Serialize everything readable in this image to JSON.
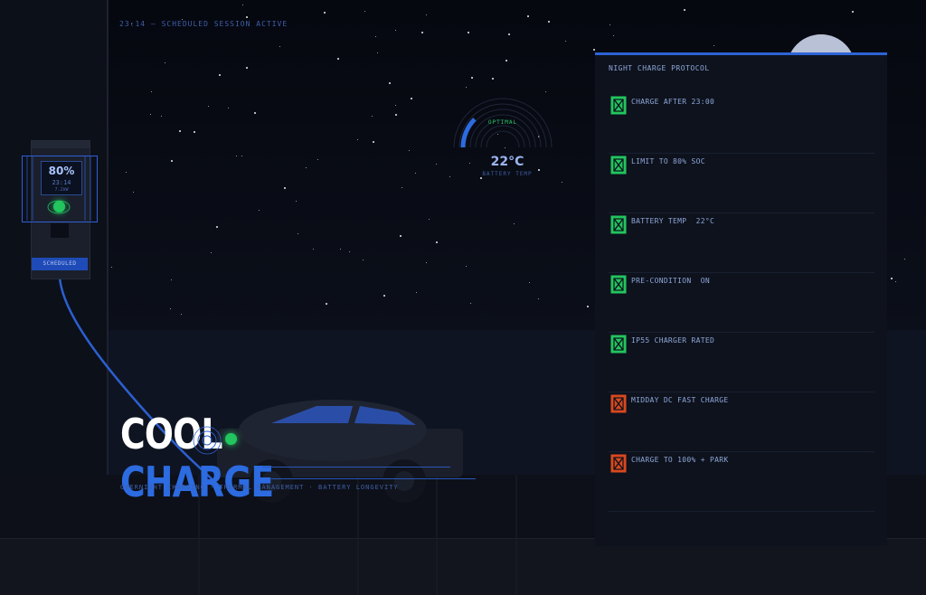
{
  "status": {
    "time": "23:14",
    "message": "SCHEDULED SESSION ACTIVE"
  },
  "gauge": {
    "state": "OPTIMAL",
    "temperature": "22°C",
    "caption": "BATTERY TEMP",
    "fill_fraction": 0.25
  },
  "charger": {
    "percent": "80%",
    "time": "23:14",
    "power": "7.2kW",
    "badge": "SCHEDULED"
  },
  "hero": {
    "title_line1": "COOL",
    "title_line2": "CHARGE",
    "subtitle": "OVERNIGHT CHARGING · THERMAL MANAGEMENT · BATTERY LONGEVITY"
  },
  "panel": {
    "title": "NIGHT CHARGE PROTOCOL",
    "items": [
      {
        "label": "CHARGE AFTER 23:00",
        "state": "good"
      },
      {
        "label": "LIMIT TO 80% SOC",
        "state": "good"
      },
      {
        "label": "BATTERY TEMP  22°C",
        "state": "good"
      },
      {
        "label": "PRE-CONDITION  ON",
        "state": "good"
      },
      {
        "label": "IP55 CHARGER RATED",
        "state": "good"
      },
      {
        "label": "MIDDAY DC FAST CHARGE",
        "state": "bad"
      },
      {
        "label": "CHARGE TO 100% + PARK",
        "state": "bad"
      }
    ]
  },
  "colors": {
    "accent": "#2c6be0",
    "good": "#22c55e",
    "bad": "#d9481e",
    "panel_bg": "#0d121d"
  }
}
